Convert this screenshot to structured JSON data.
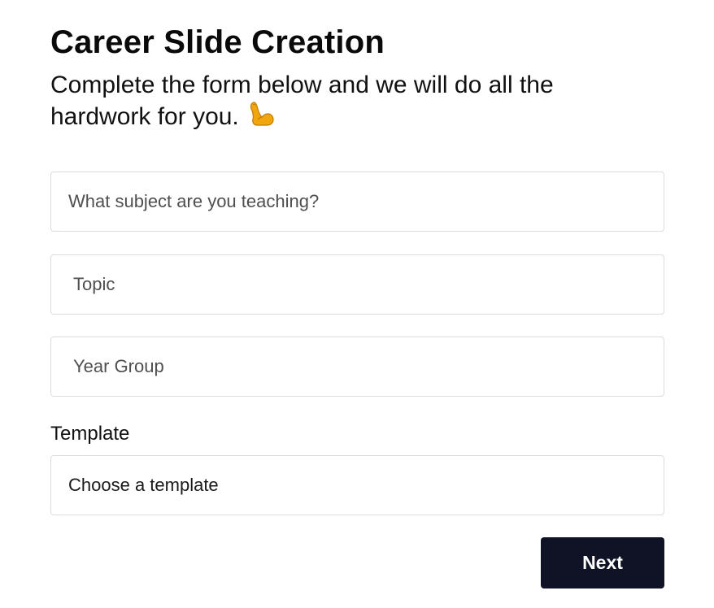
{
  "header": {
    "title": "Career Slide Creation",
    "subtitle": "Complete the form below and we will do all the hardwork for you.",
    "subtitle_icon": "flexed-biceps-emoji"
  },
  "form": {
    "subject_placeholder": "What subject are you teaching?",
    "topic_placeholder": "Topic",
    "year_group_placeholder": "Year Group",
    "template_label": "Template",
    "template_selected": "Choose a template",
    "next_label": "Next"
  },
  "colors": {
    "button_bg": "#101325",
    "button_text": "#ffffff",
    "field_border": "#dcdcdc",
    "emoji_fill": "#f2a60e"
  }
}
